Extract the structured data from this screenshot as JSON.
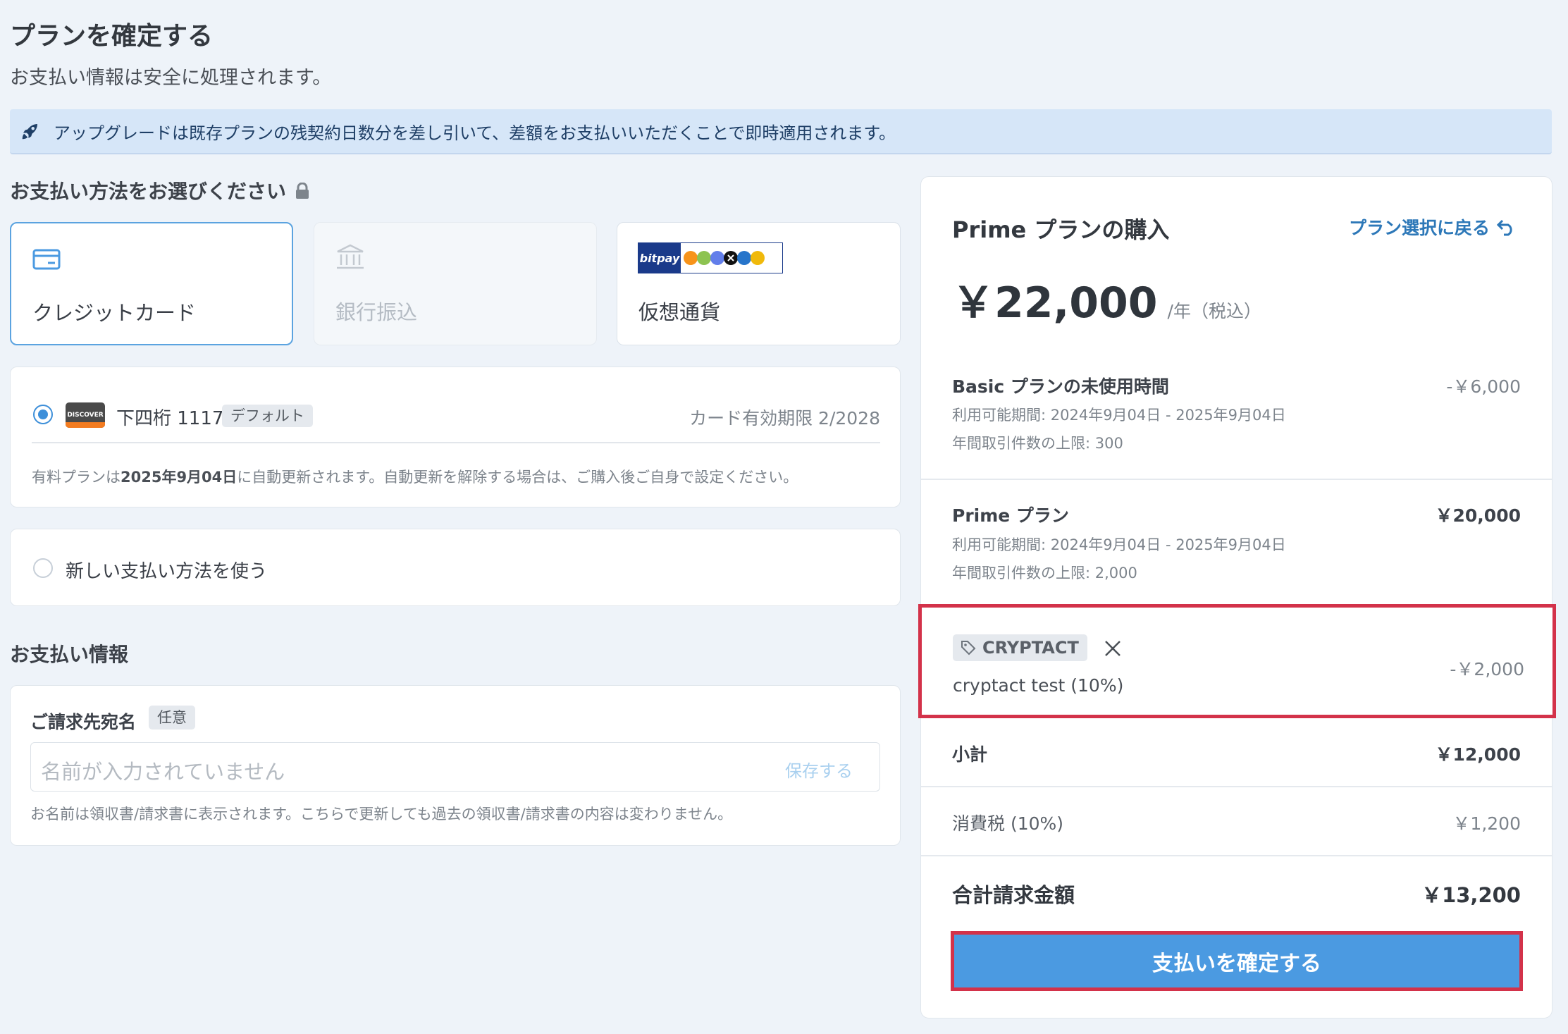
{
  "header": {
    "title": "プランを確定する",
    "subtitle": "お支払い情報は安全に処理されます。"
  },
  "notice": {
    "icon": "rocket-icon",
    "text": "アップグレードは既存プランの残契約日数分を差し引いて、差額をお支払いいただくことで即時適用されます。"
  },
  "payment_method": {
    "section_title": "お支払い方法をお選びください",
    "options": [
      {
        "label": "クレジットカード",
        "icon": "credit-card-icon",
        "state": "selected"
      },
      {
        "label": "銀行振込",
        "icon": "bank-icon",
        "state": "disabled"
      },
      {
        "label": "仮想通貨",
        "icon": "bitpay-logo",
        "logo_text": "bitpay",
        "state": "normal"
      }
    ]
  },
  "saved_card": {
    "brand": "DISCOVER",
    "last4_label": "下四桁 1117",
    "default_badge": "デフォルト",
    "expiry": "カード有効期限 2/2028",
    "note_prefix": "有料プランは",
    "note_date": "2025年9月04日",
    "note_suffix": "に自動更新されます。自動更新を解除する場合は、ご購入後ご自身で設定ください。"
  },
  "new_method": {
    "label": "新しい支払い方法を使う"
  },
  "billing": {
    "section_title": "お支払い情報",
    "field_label": "ご請求先宛名",
    "optional_badge": "任意",
    "placeholder": "名前が入力されていません",
    "save_label": "保存する",
    "help": "お名前は領収書/請求書に表示されます。こちらで更新しても過去の領収書/請求書の内容は変わりません。"
  },
  "summary": {
    "title": "Prime プランの購入",
    "back_link": "プラン選択に戻る",
    "price": "￥22,000",
    "price_unit": "/年（税込）",
    "items": [
      {
        "name": "Basic プランの未使用時間",
        "amount": "-￥6,000",
        "period": "利用可能期間: 2024年9月04日 - 2025年9月04日",
        "limit": "年間取引件数の上限: 300"
      },
      {
        "name": "Prime プラン",
        "amount": "￥20,000",
        "period": "利用可能期間: 2024年9月04日 - 2025年9月04日",
        "limit": "年間取引件数の上限: 2,000"
      }
    ],
    "coupon": {
      "code": "CRYPTACT",
      "description": "cryptact test (10%)",
      "amount": "-￥2,000"
    },
    "subtotal_label": "小計",
    "subtotal": "￥12,000",
    "tax_label": "消費税 (10%)",
    "tax": "￥1,200",
    "total_label": "合計請求金額",
    "total": "￥13,200",
    "confirm_label": "支払いを確定する"
  },
  "colors": {
    "accent": "#4b9ae1",
    "highlight_border": "#d3324a",
    "link": "#2d78b8"
  }
}
